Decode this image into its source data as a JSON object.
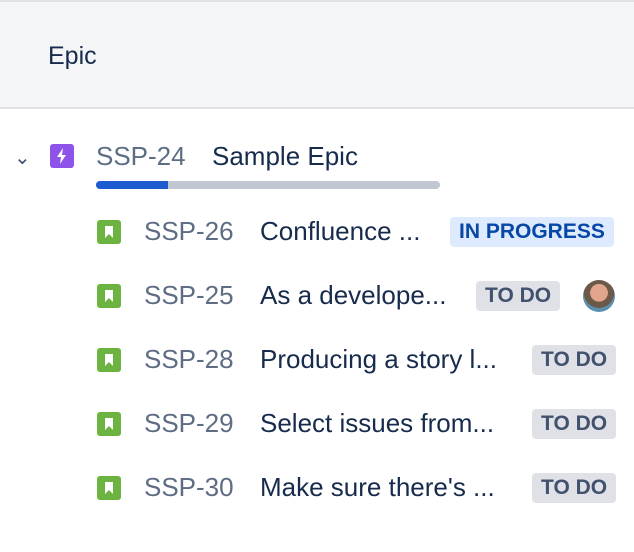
{
  "header": {
    "title": "Epic"
  },
  "epic": {
    "key": "SSP-24",
    "summary": "Sample Epic",
    "progress_percent": 21,
    "color": "#8250df",
    "icon": "epic-lightning-icon"
  },
  "issues": [
    {
      "key": "SSP-26",
      "summary": "Confluence ...",
      "status": "IN PROGRESS",
      "status_type": "inprog",
      "avatar": false
    },
    {
      "key": "SSP-25",
      "summary": "As a develope...",
      "status": "TO DO",
      "status_type": "todo",
      "avatar": true
    },
    {
      "key": "SSP-28",
      "summary": "Producing a story l...",
      "status": "TO DO",
      "status_type": "todo",
      "avatar": false
    },
    {
      "key": "SSP-29",
      "summary": "Select issues from...",
      "status": "TO DO",
      "status_type": "todo",
      "avatar": false
    },
    {
      "key": "SSP-30",
      "summary": "Make sure there's ...",
      "status": "TO DO",
      "status_type": "todo",
      "avatar": false
    }
  ],
  "story_color": "#6db33f"
}
